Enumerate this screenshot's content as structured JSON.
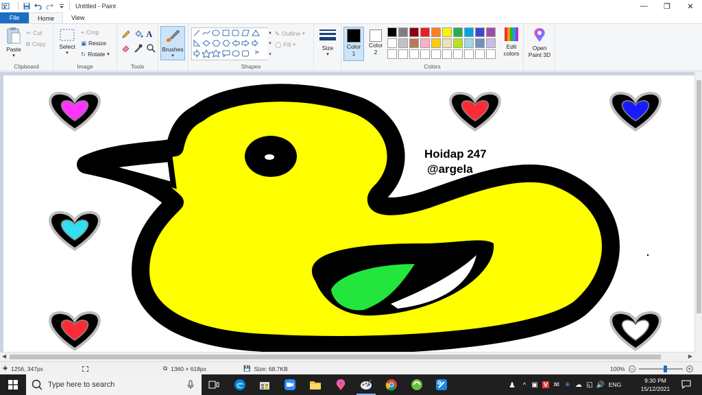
{
  "window": {
    "title": "Untitled - Paint"
  },
  "tabs": {
    "file": "File",
    "home": "Home",
    "view": "View"
  },
  "clipboard": {
    "paste": "Paste",
    "cut": "Cut",
    "copy": "Copy",
    "label": "Clipboard"
  },
  "image": {
    "select": "Select",
    "crop": "Crop",
    "resize": "Resize",
    "rotate": "Rotate",
    "label": "Image"
  },
  "tools": {
    "label": "Tools",
    "text_glyph": "A"
  },
  "brushes": {
    "label": "Brushes"
  },
  "shapes": {
    "label": "Shapes",
    "outline": "Outline",
    "fill": "Fill"
  },
  "size": {
    "label": "Size"
  },
  "colors_group": {
    "color1": "Color",
    "color1_num": "1",
    "color2": "Color",
    "color2_num": "2",
    "label": "Colors",
    "edit_colors_1": "Edit",
    "edit_colors_2": "colors",
    "palette_row1": [
      "#000000",
      "#7f7f7f",
      "#880015",
      "#ed1c24",
      "#ff7f27",
      "#fff200",
      "#22b14c",
      "#00a2e8",
      "#3f48cc",
      "#a349a4"
    ],
    "palette_row2": [
      "#ffffff",
      "#c3c3c3",
      "#b97a57",
      "#ffaec9",
      "#ffc90e",
      "#efe4b0",
      "#b5e61d",
      "#99d9ea",
      "#7092be",
      "#c8bfe7"
    ]
  },
  "paint3d": {
    "line1": "Open",
    "line2": "Paint 3D"
  },
  "canvas": {
    "text_line1": "Hoidap 247",
    "text_line2": "@argela",
    "duck_color": "#ffff00",
    "leaf_color": "#22e63c",
    "hearts": [
      "#ff33ff",
      "#ff2a36",
      "#1a1aff",
      "#33e0f0",
      "#ff2a36",
      "#ffffff"
    ]
  },
  "status": {
    "cursor": "1256, 347px",
    "dimensions": "1360 × 618px",
    "size": "Size: 68.7KB",
    "zoom": "100%",
    "zoom_fraction": 0.62
  },
  "taskbar": {
    "search_placeholder": "Type here to search",
    "lang": "ENG",
    "time": "9:30 PM",
    "date": "15/12/2021"
  }
}
